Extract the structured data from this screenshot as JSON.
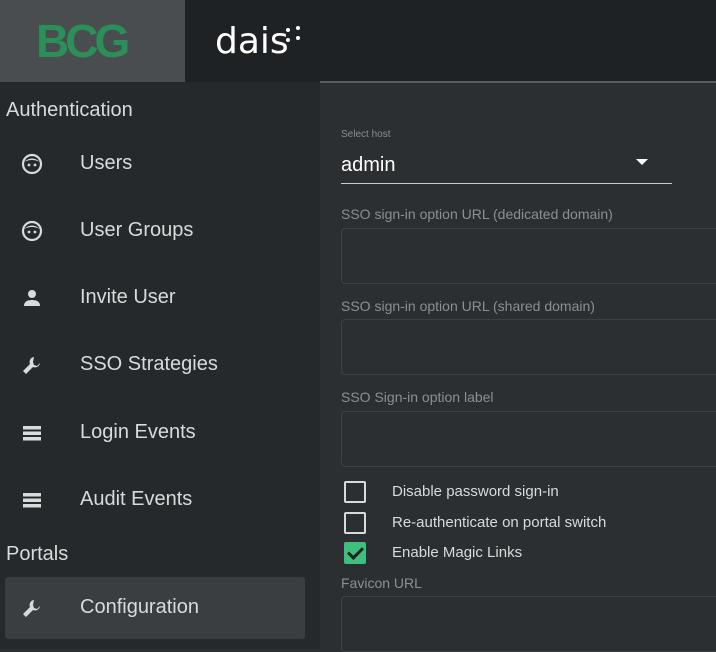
{
  "header": {
    "logo_text": "BCG",
    "brand_name": "dais"
  },
  "sidebar": {
    "sections": [
      {
        "title": "Authentication",
        "items": [
          {
            "label": "Users",
            "icon": "face-icon"
          },
          {
            "label": "User Groups",
            "icon": "face-icon"
          },
          {
            "label": "Invite User",
            "icon": "person-icon"
          },
          {
            "label": "SSO Strategies",
            "icon": "wrench-icon"
          },
          {
            "label": "Login Events",
            "icon": "list-icon"
          },
          {
            "label": "Audit Events",
            "icon": "list-icon"
          }
        ]
      },
      {
        "title": "Portals",
        "items": [
          {
            "label": "Configuration",
            "icon": "wrench-icon",
            "active": true
          }
        ]
      }
    ]
  },
  "main": {
    "host_select": {
      "label": "Select host",
      "value": "admin"
    },
    "fields": [
      {
        "label": "SSO sign-in option URL (dedicated domain)",
        "value": ""
      },
      {
        "label": "SSO sign-in option URL (shared domain)",
        "value": ""
      },
      {
        "label": "SSO Sign-in option label",
        "value": ""
      }
    ],
    "checkboxes": [
      {
        "label": "Disable password sign-in",
        "checked": false
      },
      {
        "label": "Re-authenticate on portal switch",
        "checked": false
      },
      {
        "label": "Enable Magic Links",
        "checked": true
      }
    ],
    "favicon": {
      "label": "Favicon URL",
      "value": ""
    }
  },
  "colors": {
    "accent": "#3fbf7f",
    "logo_green": "#2a8f58",
    "sidebar_bg": "#25292b",
    "topbar_bg": "#1f2224"
  }
}
